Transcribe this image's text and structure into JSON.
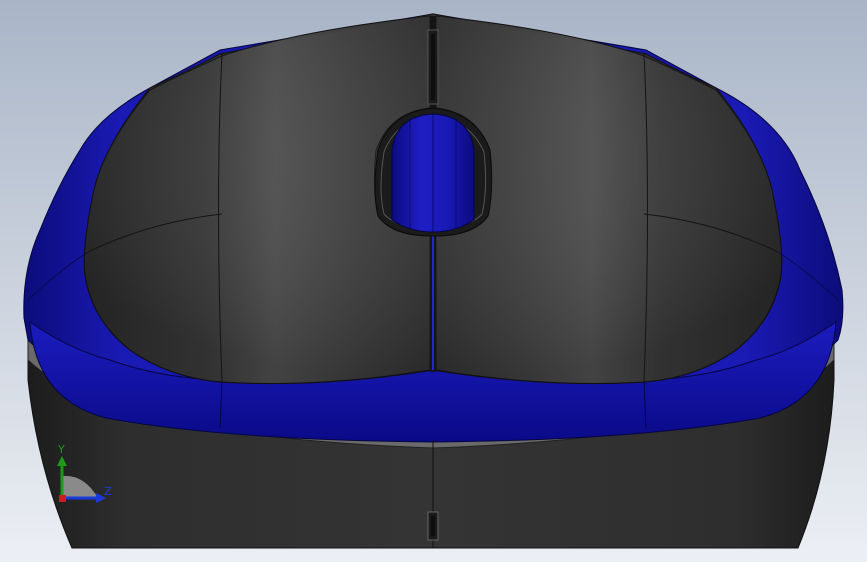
{
  "viewport": {
    "background_top": "#a9b5c7",
    "background_bottom": "#eceff4"
  },
  "model": {
    "shell_color": "#2c2c2c",
    "accent_color": "#1414a6"
  },
  "triad": {
    "y_label": "Y",
    "z_label": "Z",
    "y_color": "#1a9b1a",
    "z_color": "#1a3adb",
    "x_color": "#c81e1e"
  }
}
